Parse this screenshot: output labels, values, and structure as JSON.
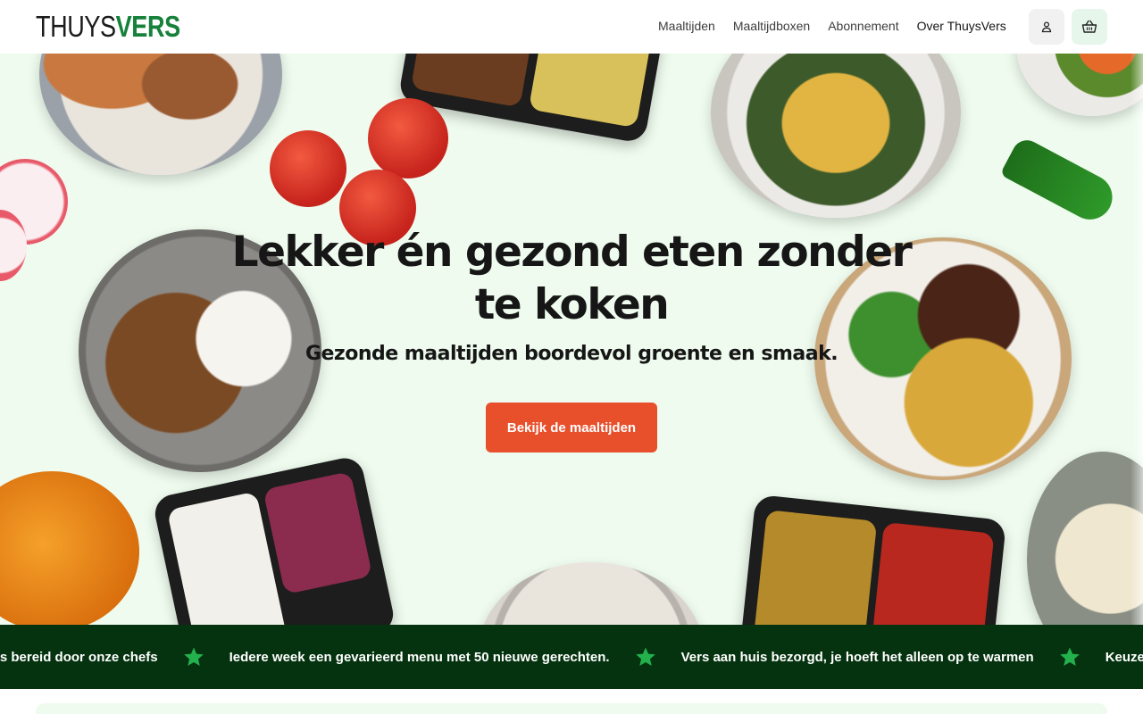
{
  "header": {
    "logo_part_a": "THUYS",
    "logo_part_b": "VERS",
    "nav": [
      "Maaltijden",
      "Maaltijdboxen",
      "Abonnement",
      "Over ThuysVers"
    ],
    "account_icon": "user-icon",
    "cart_icon": "basket-icon"
  },
  "hero": {
    "title": "Lekker én gezond eten zonder te koken",
    "subtitle": "Gezonde maaltijden boordevol groente en smaak.",
    "cta_label": "Bekijk de maaltijden"
  },
  "marquee": {
    "items": [
      "g vers bereid door onze chefs",
      "Iedere week een gevarieerd menu met 50 nieuwe gerechten.",
      "Vers aan huis bezorgd, je hoeft het alleen op te warmen",
      "Keuze i"
    ],
    "separator_icon": "star-icon"
  },
  "colors": {
    "brand_green": "#16813b",
    "hero_background": "#eefbee",
    "cta": "#e8502c",
    "marquee_background": "#05330f",
    "star": "#22b14c"
  }
}
